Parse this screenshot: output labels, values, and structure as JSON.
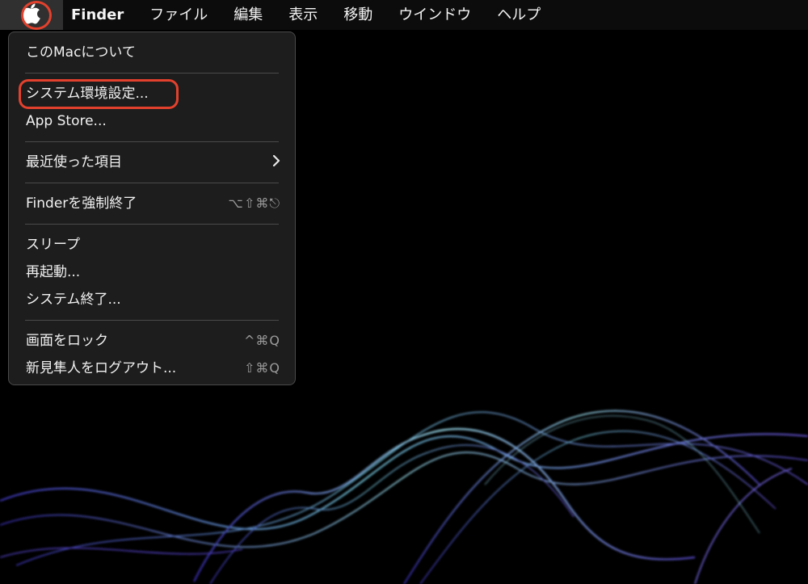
{
  "menubar": {
    "app_name": "Finder",
    "items": [
      "ファイル",
      "編集",
      "表示",
      "移動",
      "ウインドウ",
      "ヘルプ"
    ]
  },
  "apple_menu": {
    "items": [
      {
        "label": "このMacについて",
        "shortcut": ""
      },
      {
        "label": "システム環境設定...",
        "shortcut": ""
      },
      {
        "label": "App Store...",
        "shortcut": ""
      },
      {
        "label": "最近使った項目",
        "shortcut": ""
      },
      {
        "label": "Finderを強制終了",
        "shortcut": "⌥⇧⌘⎋"
      },
      {
        "label": "スリープ",
        "shortcut": ""
      },
      {
        "label": "再起動...",
        "shortcut": ""
      },
      {
        "label": "システム終了...",
        "shortcut": ""
      },
      {
        "label": "画面をロック",
        "shortcut": "^⌘Q"
      },
      {
        "label": "新見隼人をログアウト...",
        "shortcut": "⇧⌘Q"
      }
    ]
  },
  "colors": {
    "highlight": "#e3412d",
    "menu_bg": "#1e1e1e",
    "menubar_bg": "#0c0c0c"
  },
  "icons": {
    "apple": "apple-logo-icon",
    "submenu": "chevron-right-icon"
  }
}
